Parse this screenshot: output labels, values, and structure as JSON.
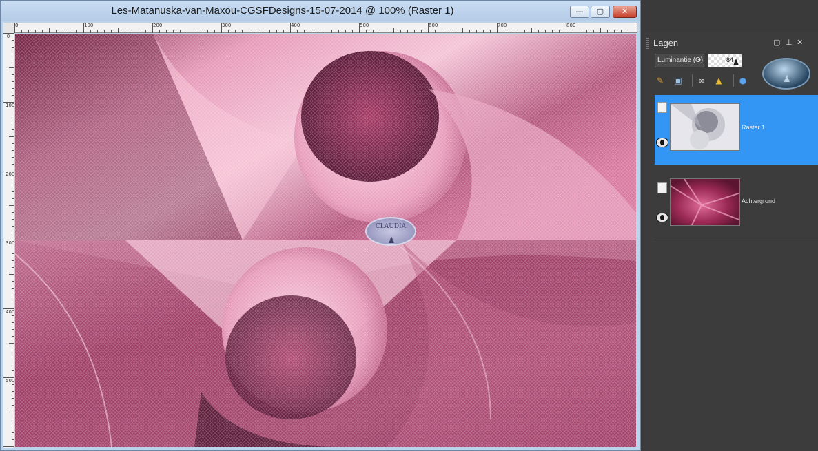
{
  "window": {
    "title": "Les-Matanuska-van-Maxou-CGSFDesigns-15-07-2014 @ 100% (Raster 1)",
    "minimize_label": "—",
    "maximize_label": "▢",
    "close_label": "✕"
  },
  "rulers": {
    "horizontal_labels": [
      "0",
      "100",
      "200",
      "300",
      "400",
      "500",
      "600",
      "700",
      "800"
    ],
    "vertical_labels": [
      "0",
      "100",
      "200",
      "300",
      "400",
      "500"
    ]
  },
  "canvas": {
    "watermark_text": "CLAUDIA"
  },
  "layers_panel": {
    "title": "Lagen",
    "controls": [
      "maximize-icon",
      "pin-icon",
      "close-icon"
    ],
    "blend_mode": "Luminantie (O)",
    "opacity": "84",
    "toolbar_icons": [
      "edit-layer-icon",
      "mask-icon",
      "link-icon",
      "lock-icon",
      "effects-icon"
    ],
    "layers": [
      {
        "name": "Raster 1",
        "selected": true,
        "visible": true
      },
      {
        "name": "Achtergrond",
        "selected": false,
        "visible": true
      }
    ]
  },
  "colors": {
    "selected_layer": "#3396f4",
    "panel_bg": "#3c3c3c",
    "window_chrome": "#bcd3ec",
    "canvas_primary": "#9c3f63",
    "canvas_light": "#f2b3cb"
  }
}
